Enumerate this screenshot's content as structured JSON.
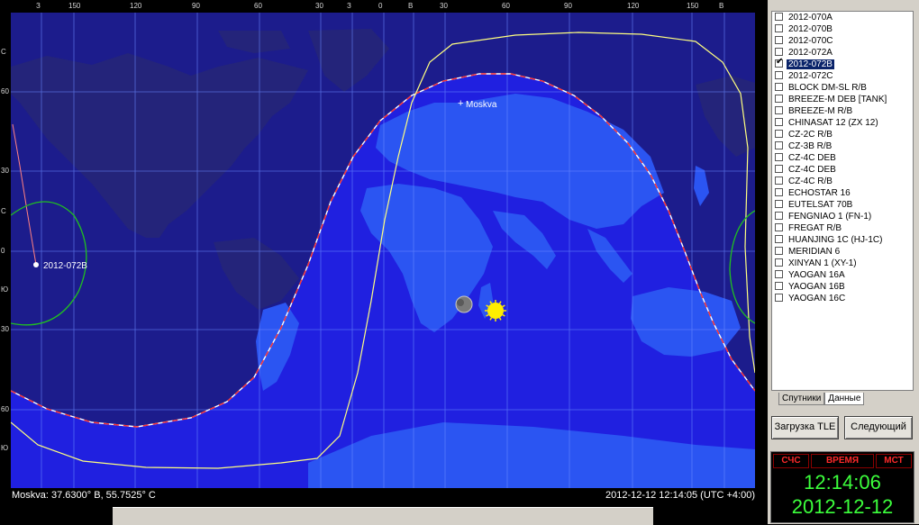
{
  "top_axis": [
    "З",
    "150",
    "120",
    "90",
    "60",
    "30",
    "З",
    "0",
    "В",
    "30",
    "60",
    "90",
    "120",
    "150",
    "В"
  ],
  "left_axis": [
    "С",
    "60",
    "30",
    "С",
    "0",
    "Ю",
    "30",
    "60",
    "Ю"
  ],
  "map": {
    "city_label": "Moskva",
    "satellite_label": "2012-072B",
    "colors": {
      "night": "#1c1c8c",
      "day": "#2020e0",
      "land_night": "#232370",
      "land_day": "#2850f0",
      "grid": "#6a8aff",
      "orbit": "#ffff80",
      "terminator": "#ff3030"
    }
  },
  "satellites": [
    {
      "name": "2012-070A",
      "checked": false,
      "selected": false
    },
    {
      "name": "2012-070B",
      "checked": false,
      "selected": false
    },
    {
      "name": "2012-070C",
      "checked": false,
      "selected": false
    },
    {
      "name": "2012-072A",
      "checked": false,
      "selected": false
    },
    {
      "name": "2012-072B",
      "checked": true,
      "selected": true
    },
    {
      "name": "2012-072C",
      "checked": false,
      "selected": false
    },
    {
      "name": "BLOCK DM-SL R/B",
      "checked": false,
      "selected": false
    },
    {
      "name": "BREEZE-M DEB [TANK]",
      "checked": false,
      "selected": false
    },
    {
      "name": "BREEZE-M R/B",
      "checked": false,
      "selected": false
    },
    {
      "name": "CHINASAT 12 (ZX 12)",
      "checked": false,
      "selected": false
    },
    {
      "name": "CZ-2C R/B",
      "checked": false,
      "selected": false
    },
    {
      "name": "CZ-3B R/B",
      "checked": false,
      "selected": false
    },
    {
      "name": "CZ-4C DEB",
      "checked": false,
      "selected": false
    },
    {
      "name": "CZ-4C DEB",
      "checked": false,
      "selected": false
    },
    {
      "name": "CZ-4C R/B",
      "checked": false,
      "selected": false
    },
    {
      "name": "ECHOSTAR 16",
      "checked": false,
      "selected": false
    },
    {
      "name": "EUTELSAT 70B",
      "checked": false,
      "selected": false
    },
    {
      "name": "FENGNIAO 1 (FN-1)",
      "checked": false,
      "selected": false
    },
    {
      "name": "FREGAT R/B",
      "checked": false,
      "selected": false
    },
    {
      "name": "HUANJING 1C (HJ-1C)",
      "checked": false,
      "selected": false
    },
    {
      "name": "MERIDIAN 6",
      "checked": false,
      "selected": false
    },
    {
      "name": "XINYAN 1 (XY-1)",
      "checked": false,
      "selected": false
    },
    {
      "name": "YAOGAN 16A",
      "checked": false,
      "selected": false
    },
    {
      "name": "YAOGAN 16B",
      "checked": false,
      "selected": false
    },
    {
      "name": "YAOGAN 16C",
      "checked": false,
      "selected": false
    }
  ],
  "tabs": {
    "satellites": "Спутники",
    "data": "Данные"
  },
  "buttons": {
    "load_tle": "Загрузка TLE",
    "next": "Следующий"
  },
  "clock": {
    "tab_scs": "СЧС",
    "tab_time": "ВРЕМЯ",
    "tab_mst": "МСТ",
    "time": "12:14:06",
    "date": "2012-12-12"
  },
  "status": {
    "location": "Moskva: 37.6300° В, 55.7525° С",
    "datetime": "2012-12-12 12:14:05 (UTC +4:00)"
  }
}
